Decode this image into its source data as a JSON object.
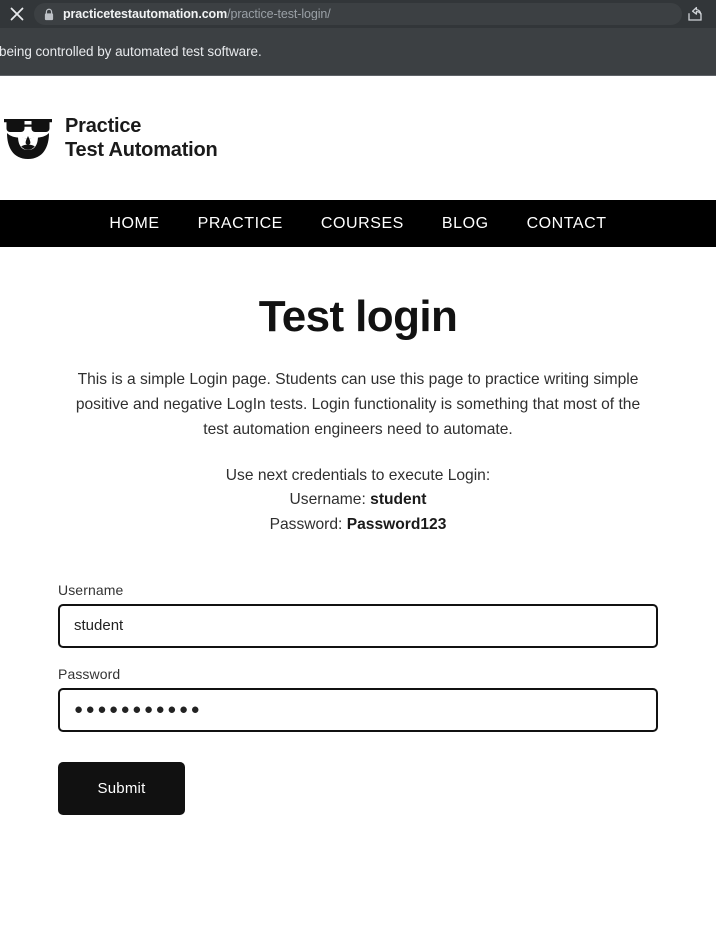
{
  "browser": {
    "close_icon": "close-icon",
    "lock_icon": "lock-icon",
    "share_icon": "share-icon",
    "url_domain": "practicetestautomation.com",
    "url_path": "/practice-test-login/",
    "infobar_text": "being controlled by automated test software.",
    "chrome_bg": "#323639",
    "infobar_bg": "#3c4043"
  },
  "site": {
    "logo_icon": "bearded-face-glasses-logo-icon",
    "logo_line1": "Practice",
    "logo_line2": "Test Automation",
    "nav": [
      {
        "label": "HOME"
      },
      {
        "label": "PRACTICE"
      },
      {
        "label": "COURSES"
      },
      {
        "label": "BLOG"
      },
      {
        "label": "CONTACT"
      }
    ],
    "nav_bg": "#000000"
  },
  "main": {
    "title": "Test login",
    "intro": "This is a simple Login page. Students can use this page to practice writing simple positive and negative LogIn tests. Login functionality is something that most of the test automation engineers need to automate.",
    "credentials_intro": "Use next credentials to execute Login:",
    "credentials_username_label": "Username: ",
    "credentials_username_value": "student",
    "credentials_password_label": "Password: ",
    "credentials_password_value": "Password123"
  },
  "form": {
    "username_label": "Username",
    "username_value": "student",
    "username_placeholder": "Username",
    "password_label": "Password",
    "password_masked": "●●●●●●●●●●●",
    "password_placeholder": "Password",
    "submit_label": "Submit",
    "submit_bg": "#111111"
  }
}
